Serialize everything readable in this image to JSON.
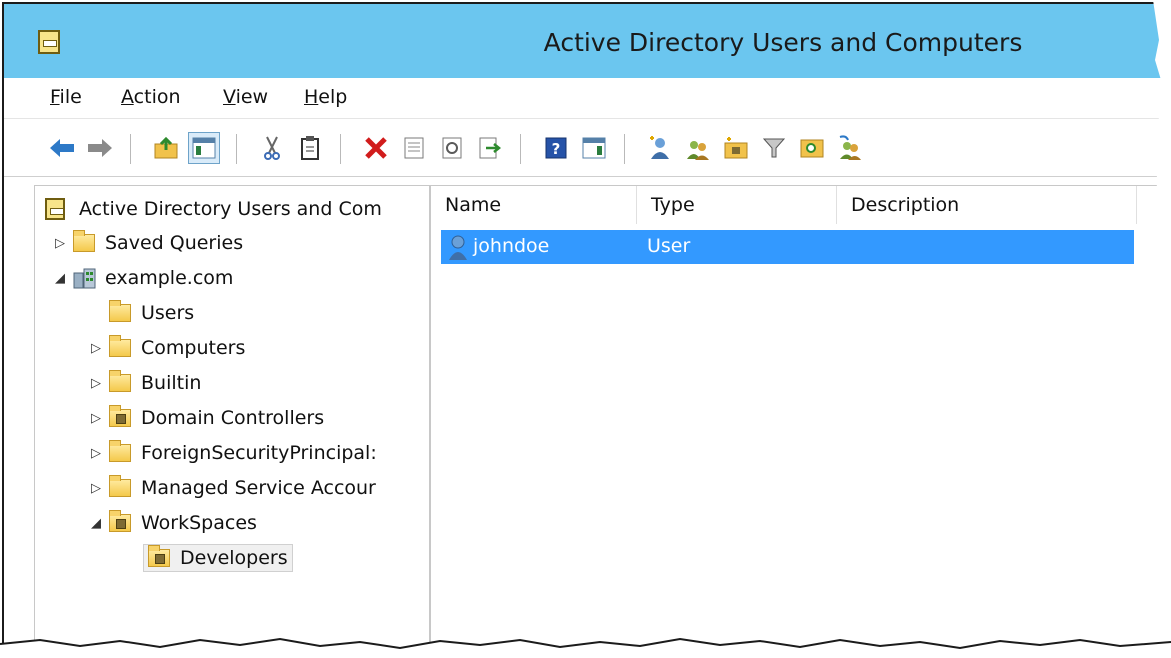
{
  "window": {
    "title": "Active Directory Users and Computers"
  },
  "menu": [
    "File",
    "Action",
    "View",
    "Help"
  ],
  "toolbar": {
    "buttons": [
      "back-icon",
      "forward-icon",
      "up-folder-icon",
      "show-hide-console-tree-icon",
      "cut-icon",
      "copy-icon",
      "delete-icon",
      "properties-icon",
      "refresh-icon",
      "export-list-icon",
      "help-icon",
      "show-hide-action-pane-icon",
      "create-user-icon",
      "create-group-icon",
      "create-ou-icon",
      "filter-icon",
      "find-icon",
      "add-to-group-icon"
    ]
  },
  "tree": {
    "root": "Active Directory Users and Com",
    "items": [
      {
        "label": "Saved Queries",
        "expander": "▷"
      },
      {
        "label": "example.com",
        "expander": "◢"
      },
      {
        "label": "Users",
        "expander": ""
      },
      {
        "label": "Computers",
        "expander": "▷"
      },
      {
        "label": "Builtin",
        "expander": "▷"
      },
      {
        "label": "Domain Controllers",
        "expander": "▷"
      },
      {
        "label": "ForeignSecurityPrincipal:",
        "expander": "▷"
      },
      {
        "label": "Managed Service Accour",
        "expander": "▷"
      },
      {
        "label": "WorkSpaces",
        "expander": "◢"
      },
      {
        "label": "Developers",
        "expander": ""
      }
    ]
  },
  "list": {
    "columns": [
      "Name",
      "Type",
      "Description"
    ],
    "rows": [
      {
        "name": "johndoe",
        "type": "User",
        "description": ""
      }
    ]
  },
  "colors": {
    "titlebar": "#6bc6ef",
    "selection": "#3399ff"
  }
}
